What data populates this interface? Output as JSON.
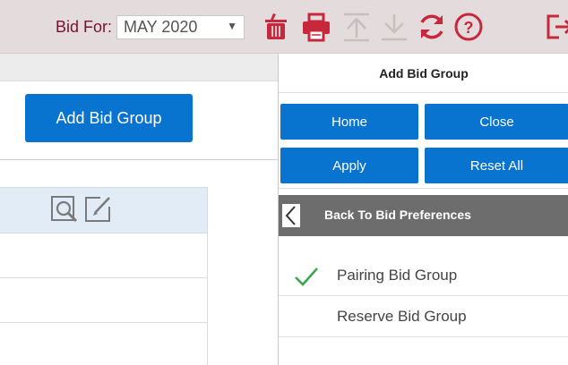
{
  "toolbar": {
    "bid_for_label": "Bid For:",
    "bid_month": "MAY 2020",
    "dropdown_arrow": "▼",
    "icons": [
      "trash-icon",
      "print-icon",
      "upload-icon",
      "download-icon",
      "refresh-icon",
      "help-icon",
      "exit-icon"
    ],
    "accent_color": "#c8283c",
    "disabled_color": "#c7bebe"
  },
  "left": {
    "add_bid_group_label": "Add Bid Group",
    "table_icons": [
      "preview-icon",
      "edit-icon"
    ]
  },
  "panel": {
    "title": "Add Bid Group",
    "buttons": {
      "home": "Home",
      "close": "Close",
      "apply": "Apply",
      "reset_all": "Reset All"
    },
    "back_label": "Back To Bid Preferences",
    "options": [
      {
        "label": "Pairing Bid Group",
        "selected": true
      },
      {
        "label": "Reserve Bid Group",
        "selected": false
      }
    ],
    "button_color": "#0874d0",
    "check_color": "#3aa64a"
  }
}
